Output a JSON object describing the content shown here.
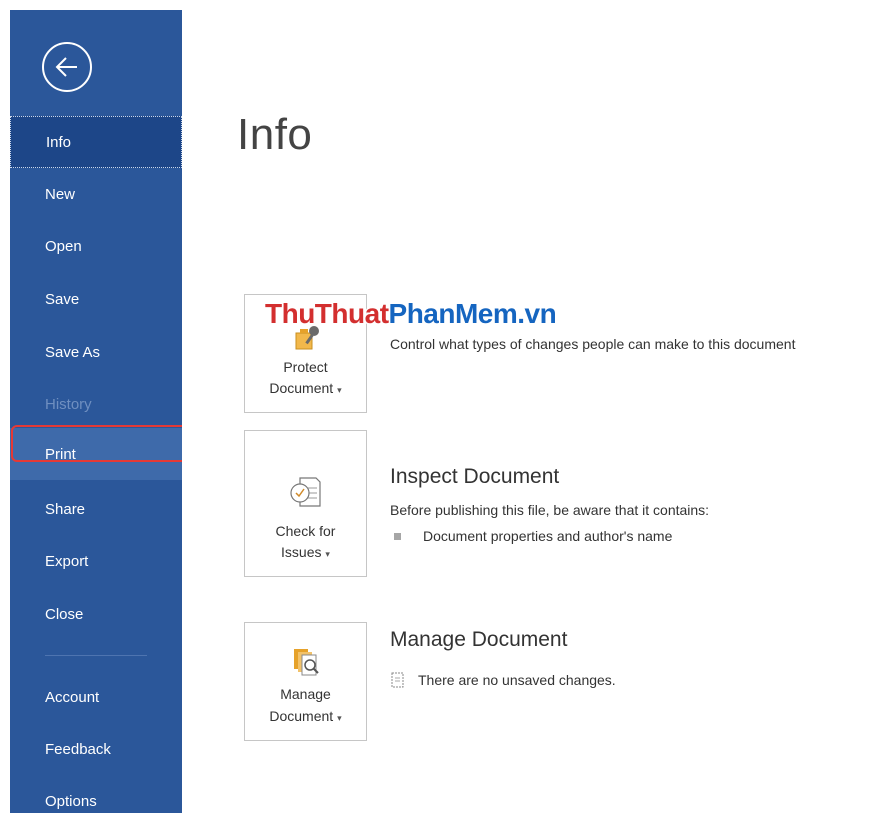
{
  "sidebar": {
    "back_label": "Back",
    "items": [
      {
        "label": "Info"
      },
      {
        "label": "New"
      },
      {
        "label": "Open"
      },
      {
        "label": "Save"
      },
      {
        "label": "Save As"
      },
      {
        "label": "History"
      },
      {
        "label": "Print"
      },
      {
        "label": "Share"
      },
      {
        "label": "Export"
      },
      {
        "label": "Close"
      },
      {
        "label": "Account"
      },
      {
        "label": "Feedback"
      },
      {
        "label": "Options"
      }
    ]
  },
  "main": {
    "title": "Info",
    "sections": [
      {
        "tile_line1": "Protect",
        "tile_line2": "Document",
        "title": "",
        "description": "Control what types of changes people can make to this document"
      },
      {
        "tile_line1": "Check for",
        "tile_line2": "Issues",
        "title": "Inspect Document",
        "description": "Before publishing this file, be aware that it contains:",
        "bullet": "Document properties and author's name"
      },
      {
        "tile_line1": "Manage",
        "tile_line2": "Document",
        "title": "Manage Document",
        "description": "There are no unsaved changes."
      }
    ]
  },
  "watermark": {
    "part1": "ThuThuat",
    "part2": "PhanMem",
    "part3": ".vn"
  },
  "colors": {
    "sidebar": "#2b579a",
    "sidebar_active": "#1d4688",
    "highlight": "#e53935",
    "watermark_red": "#d32f2f",
    "watermark_blue": "#1565c0"
  }
}
